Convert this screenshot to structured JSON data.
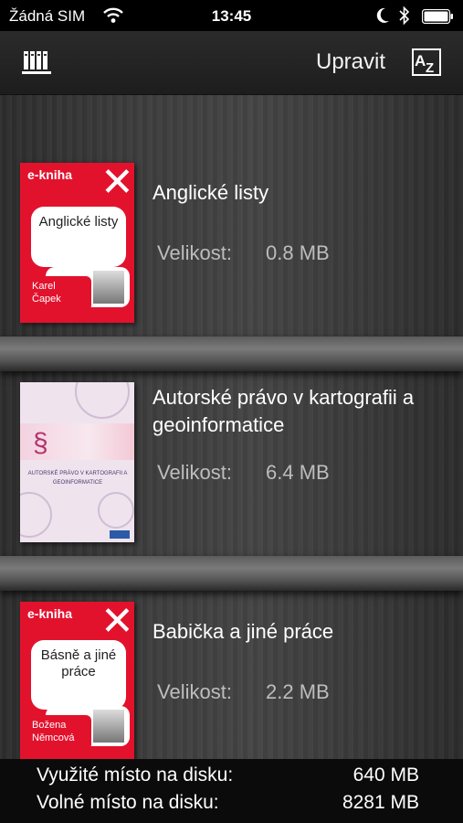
{
  "status_bar": {
    "carrier": "Žádná SIM",
    "time": "13:45"
  },
  "toolbar": {
    "edit_label": "Upravit",
    "sort_label": "AZ"
  },
  "books": [
    {
      "title": "Anglické listy",
      "size_label": "Velikost:",
      "size_value": "0.8 MB",
      "cover": {
        "badge": "e-kniha",
        "title": "Anglické listy",
        "author": "Karel Čapek"
      }
    },
    {
      "title": "Autorské právo v kartografii a geoinformatice",
      "size_label": "Velikost:",
      "size_value": "6.4 MB",
      "cover": {
        "symbol": "§",
        "title": "AUTORSKÉ PRÁVO V KARTOGRAFII A GEOINFORMATICE"
      }
    },
    {
      "title": "Babička a jiné práce",
      "size_label": "Velikost:",
      "size_value": "2.2 MB",
      "cover": {
        "badge": "e-kniha",
        "title": "Básně a jiné práce",
        "author": "Božena Němcová"
      }
    }
  ],
  "disk": {
    "used_label": "Využité místo na disku:",
    "used_value": "640 MB",
    "free_label": "Volné místo na disku:",
    "free_value": "8281 MB"
  },
  "colors": {
    "ekniha_red": "#e2122d",
    "shelf_wood": "#3d3d3d"
  },
  "icons": {
    "shelf": "bookshelf-icon",
    "sort": "sort-az-icon",
    "wifi": "wifi-icon",
    "bluetooth": "bluetooth-icon",
    "battery": "battery-icon",
    "moon": "moon-icon"
  }
}
